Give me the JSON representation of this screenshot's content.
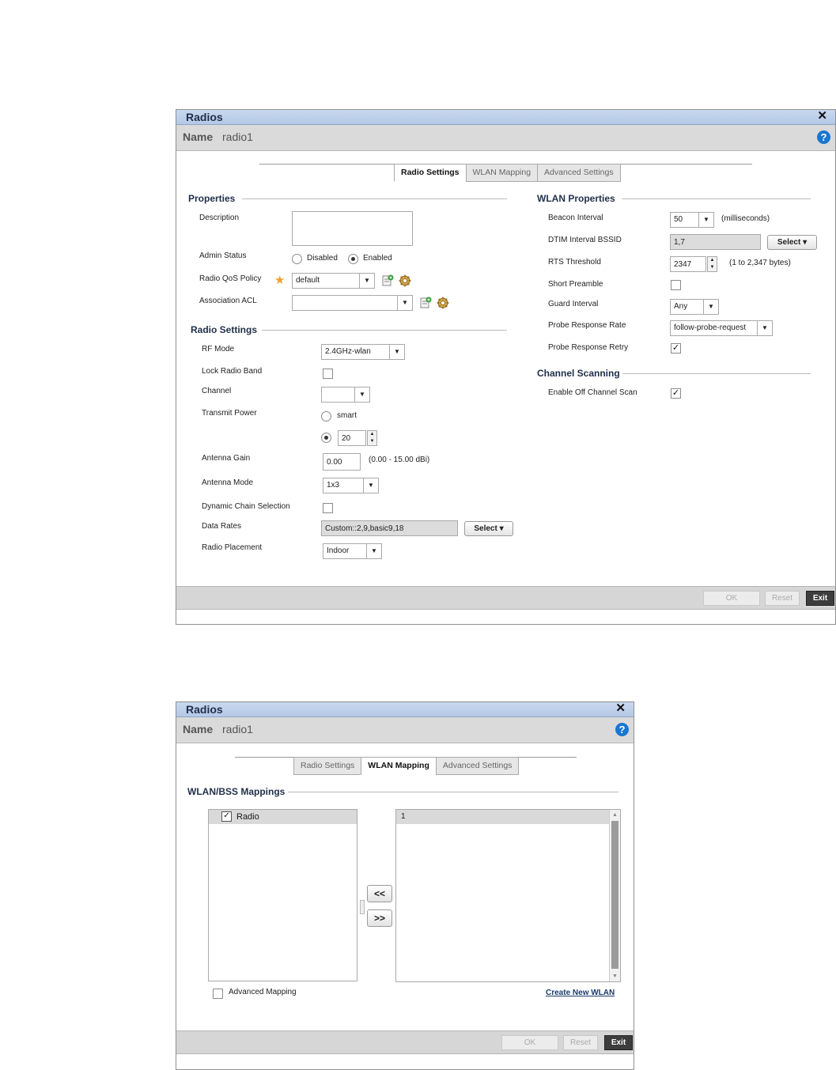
{
  "dialog1": {
    "title": "Radios",
    "close": "✕",
    "name_label": "Name",
    "name_value": "radio1",
    "help": "?",
    "tabs": [
      "Radio Settings",
      "WLAN Mapping",
      "Advanced Settings"
    ],
    "properties": {
      "header": "Properties",
      "description_label": "Description",
      "description_value": "",
      "admin_status_label": "Admin Status",
      "admin_disabled": "Disabled",
      "admin_enabled": "Enabled",
      "admin_selected": "Enabled",
      "qos_label": "Radio QoS Policy",
      "qos_value": "default",
      "acl_label": "Association ACL",
      "acl_value": ""
    },
    "radio_settings": {
      "header": "Radio Settings",
      "rf_mode_label": "RF Mode",
      "rf_mode_value": "2.4GHz-wlan",
      "lock_band_label": "Lock Radio Band",
      "lock_band_checked": false,
      "channel_label": "Channel",
      "channel_value": "",
      "tx_power_label": "Transmit Power",
      "tx_smart": "smart",
      "tx_value": "20",
      "antenna_gain_label": "Antenna Gain",
      "antenna_gain_value": "0.00",
      "antenna_gain_range": "(0.00 - 15.00 dBi)",
      "antenna_mode_label": "Antenna Mode",
      "antenna_mode_value": "1x3",
      "dcs_label": "Dynamic Chain Selection",
      "dcs_checked": false,
      "data_rates_label": "Data Rates",
      "data_rates_value": "Custom::2,9,basic9,18",
      "select_btn": "Select",
      "placement_label": "Radio Placement",
      "placement_value": "Indoor"
    },
    "wlan_properties": {
      "header": "WLAN Properties",
      "beacon_label": "Beacon Interval",
      "beacon_value": "50",
      "beacon_unit": "(milliseconds)",
      "dtim_label": "DTIM Interval BSSID",
      "dtim_value": "1,7",
      "select_btn": "Select",
      "rts_label": "RTS Threshold",
      "rts_value": "2347",
      "rts_range": "(1 to 2,347 bytes)",
      "short_preamble_label": "Short Preamble",
      "short_preamble_checked": false,
      "guard_label": "Guard Interval",
      "guard_value": "Any",
      "probe_rate_label": "Probe Response Rate",
      "probe_rate_value": "follow-probe-request",
      "probe_retry_label": "Probe Response Retry",
      "probe_retry_checked": true
    },
    "channel_scanning": {
      "header": "Channel Scanning",
      "off_channel_label": "Enable Off Channel Scan",
      "off_channel_checked": true
    },
    "footer": {
      "ok": "OK",
      "reset": "Reset",
      "exit": "Exit"
    }
  },
  "dialog2": {
    "title": "Radios",
    "close": "✕",
    "name_label": "Name",
    "name_value": "radio1",
    "help": "?",
    "tabs": [
      "Radio Settings",
      "WLAN Mapping",
      "Advanced Settings"
    ],
    "mappings_header": "WLAN/BSS Mappings",
    "left_tree_item": "Radio",
    "right_list_item": "1",
    "move_left": "<<",
    "move_right": ">>",
    "advanced_mapping_label": "Advanced Mapping",
    "advanced_mapping_checked": false,
    "create_link": "Create New WLAN",
    "footer": {
      "ok": "OK",
      "reset": "Reset",
      "exit": "Exit"
    }
  }
}
